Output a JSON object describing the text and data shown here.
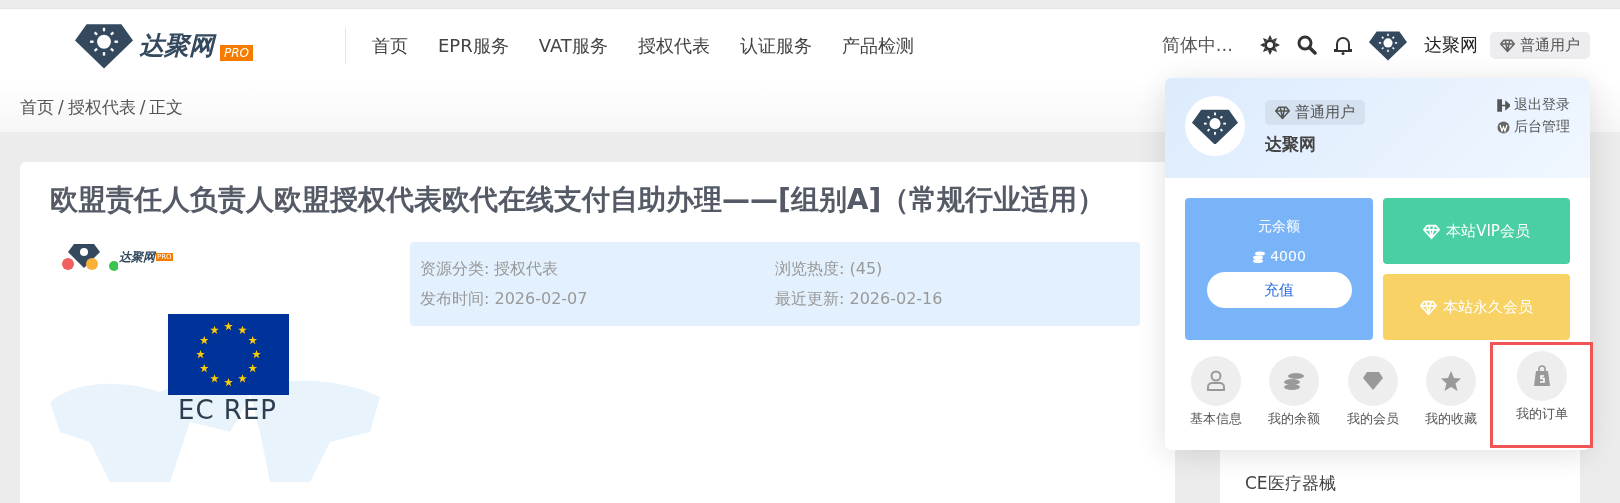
{
  "header": {
    "logo": {
      "text": "达聚网",
      "badge": "PRO"
    },
    "nav": [
      "首页",
      "EPR服务",
      "VAT服务",
      "授权代表",
      "认证服务",
      "产品检测"
    ],
    "language": "简体中...",
    "user": {
      "name": "达聚网",
      "badge": "普通用户"
    }
  },
  "breadcrumb": {
    "items": [
      "首页",
      "授权代表",
      "正文"
    ],
    "separator": "/"
  },
  "article": {
    "title": "欧盟责任人负责人欧盟授权代表欧代在线支付自助办理——[组别A]（常规行业适用）",
    "image": {
      "logo_text": "达聚网",
      "logo_badge": "PRO",
      "caption": "EC REP"
    },
    "info": [
      {
        "label": "资源分类:",
        "value": "授权代表"
      },
      {
        "label": "浏览热度:",
        "value": "(45)"
      },
      {
        "label": "发布时间:",
        "value": "2026-02-07"
      },
      {
        "label": "最近更新:",
        "value": "2026-02-16"
      }
    ]
  },
  "sidebar": {
    "items": [
      "CE医疗器械"
    ]
  },
  "user_menu": {
    "badge": "普通用户",
    "name": "达聚网",
    "links": [
      {
        "kind": "logout",
        "label": "退出登录"
      },
      {
        "kind": "admin",
        "label": "后台管理"
      }
    ],
    "balance": {
      "label": "元余额",
      "amount": "4000",
      "button": "充值"
    },
    "memberships": [
      {
        "label": "本站VIP会员",
        "color": "#4acea3"
      },
      {
        "label": "本站永久会员",
        "color": "#f8d264"
      }
    ],
    "shortcuts": [
      {
        "kind": "user",
        "label": "基本信息",
        "highlighted": false
      },
      {
        "kind": "coins",
        "label": "我的余额",
        "highlighted": false
      },
      {
        "kind": "diamond",
        "label": "我的会员",
        "highlighted": false
      },
      {
        "kind": "star",
        "label": "我的收藏",
        "highlighted": false
      },
      {
        "kind": "bag",
        "label": "我的订单",
        "highlighted": true
      }
    ]
  }
}
